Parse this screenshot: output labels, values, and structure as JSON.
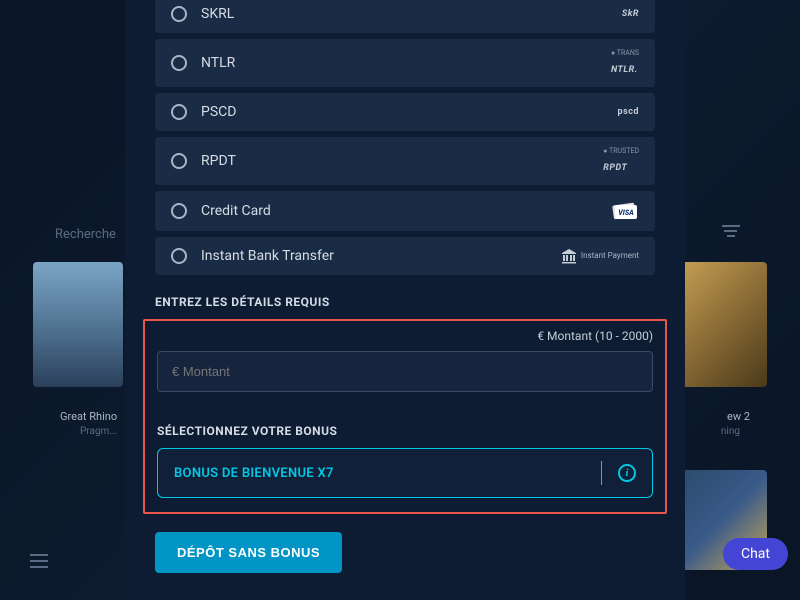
{
  "bg": {
    "search": "Recherche",
    "card_left_title": "Great Rhino",
    "card_left_sub": "Pragm...",
    "card_right_title": "ew 2",
    "card_right_sub": "ning"
  },
  "payment_methods": [
    {
      "id": "skrl",
      "label": "SKRL",
      "badge": "SkR"
    },
    {
      "id": "ntlr",
      "label": "NTLR",
      "badge": "NTLR."
    },
    {
      "id": "pscd",
      "label": "PSCD",
      "badge": "pscd"
    },
    {
      "id": "rpdt",
      "label": "RPDT",
      "badge": "RPDT"
    },
    {
      "id": "cc",
      "label": "Credit Card",
      "badge": "VISA"
    },
    {
      "id": "ibt",
      "label": "Instant Bank Transfer",
      "badge": "Instant Payment"
    }
  ],
  "section_title": "ENTREZ LES DÉTAILS REQUIS",
  "amount_range": "€ Montant (10 - 2000)",
  "amount_placeholder": "€ Montant",
  "bonus_title": "SÉLECTIONNEZ VOTRE BONUS",
  "bonus_label": "BONUS DE BIENVENUE X7",
  "deposit_btn": "DÉPÔT SANS BONUS",
  "chat": "Chat"
}
